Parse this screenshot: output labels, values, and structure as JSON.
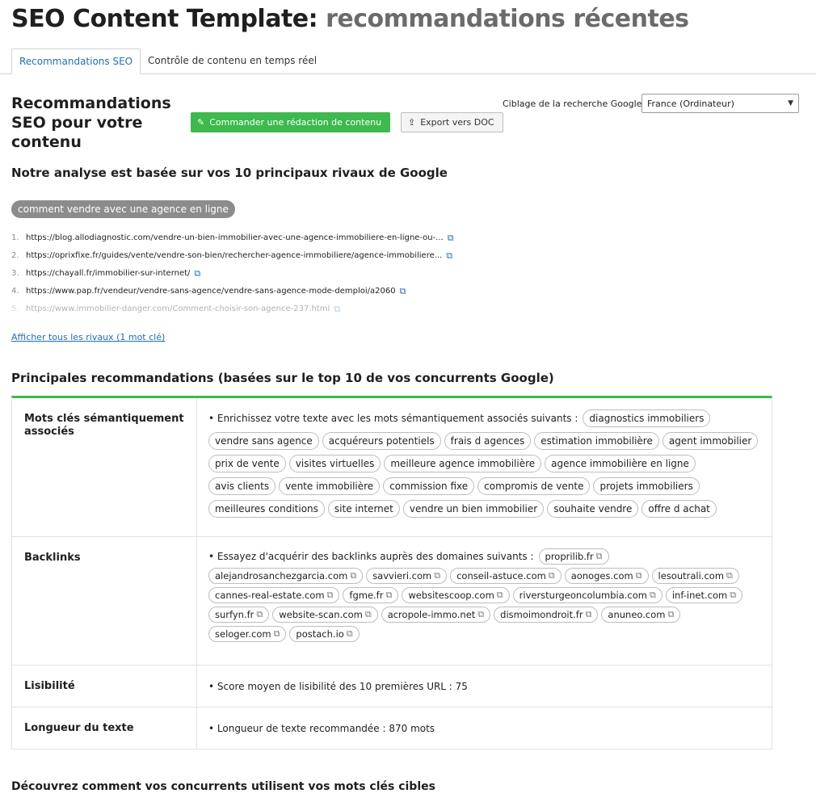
{
  "header": {
    "title_main": "SEO Content Template:",
    "title_sub": "recommandations récentes"
  },
  "tabs": [
    {
      "label": "Recommandations SEO",
      "active": true
    },
    {
      "label": "Contrôle de contenu en temps réel",
      "active": false
    }
  ],
  "section": {
    "title": "Recommandations SEO pour votre contenu",
    "order_button": "Commander une rédaction de contenu",
    "export_button": "Export vers DOC",
    "target_label": "Ciblage de la recherche Google:",
    "target_value": "France (Ordinateur)"
  },
  "analysis": {
    "title": "Notre analyse est basée sur vos 10 principaux rivaux de Google",
    "keyword": "comment vendre avec une agence en ligne",
    "rivals": [
      {
        "num": "1.",
        "url": "https://blog.allodiagnostic.com/vendre-un-bien-immobilier-avec-une-agence-immobiliere-en-ligne-ou-..."
      },
      {
        "num": "2.",
        "url": "https://oprixfixe.fr/guides/vente/vendre-son-bien/rechercher-agence-immobiliere/agence-immobiliere..."
      },
      {
        "num": "3.",
        "url": "https://chayall.fr/immobilier-sur-internet/"
      },
      {
        "num": "4.",
        "url": "https://www.pap.fr/vendeur/vendre-sans-agence/vendre-sans-agence-mode-demploi/a2060"
      },
      {
        "num": "5.",
        "url": "https://www.immobilier-danger.com/Comment-choisir-son-agence-237.html"
      }
    ],
    "show_all": "Afficher tous les rivaux (1 mot clé)"
  },
  "recommendations": {
    "title": "Principales recommandations (basées sur le top 10 de vos concurrents Google)",
    "semantic": {
      "label": "Mots clés sémantiquement associés",
      "lead": "• Enrichissez votre texte avec les mots sémantiquement associés suivants :",
      "keywords": [
        "diagnostics immobiliers",
        "vendre sans agence",
        "acquéreurs potentiels",
        "frais d agences",
        "estimation immobilière",
        "agent immobilier",
        "prix de vente",
        "visites virtuelles",
        "meilleure agence immobilière",
        "agence immobilière en ligne",
        "avis clients",
        "vente immobilière",
        "commission fixe",
        "compromis de vente",
        "projets immobiliers",
        "meilleures conditions",
        "site internet",
        "vendre un bien immobilier",
        "souhaite vendre",
        "offre d achat"
      ]
    },
    "backlinks": {
      "label": "Backlinks",
      "lead": "• Essayez d'acquérir des backlinks auprès des domaines suivants :",
      "domains": [
        "proprilib.fr",
        "alejandrosanchezgarcia.com",
        "savvieri.com",
        "conseil-astuce.com",
        "aonoges.com",
        "lesoutrali.com",
        "cannes-real-estate.com",
        "fgme.fr",
        "websitescoop.com",
        "riversturgeoncolumbia.com",
        "inf-inet.com",
        "surfyn.fr",
        "website-scan.com",
        "acropole-immo.net",
        "dismoimondroit.fr",
        "anuneo.com",
        "seloger.com",
        "postach.io"
      ]
    },
    "readability": {
      "label": "Lisibilité",
      "text": "• Score moyen de lisibilité des 10 premières URL : 75"
    },
    "length": {
      "label": "Longueur du texte",
      "text": "• Longueur de texte recommandée : 870 mots"
    }
  },
  "footer": {
    "discover": "Découvrez comment vos concurrents utilisent vos mots clés cibles"
  },
  "colors": {
    "accent_green": "#3db94d",
    "link_blue": "#1e6fb8",
    "subtitle_gray": "#6b6b6b"
  }
}
